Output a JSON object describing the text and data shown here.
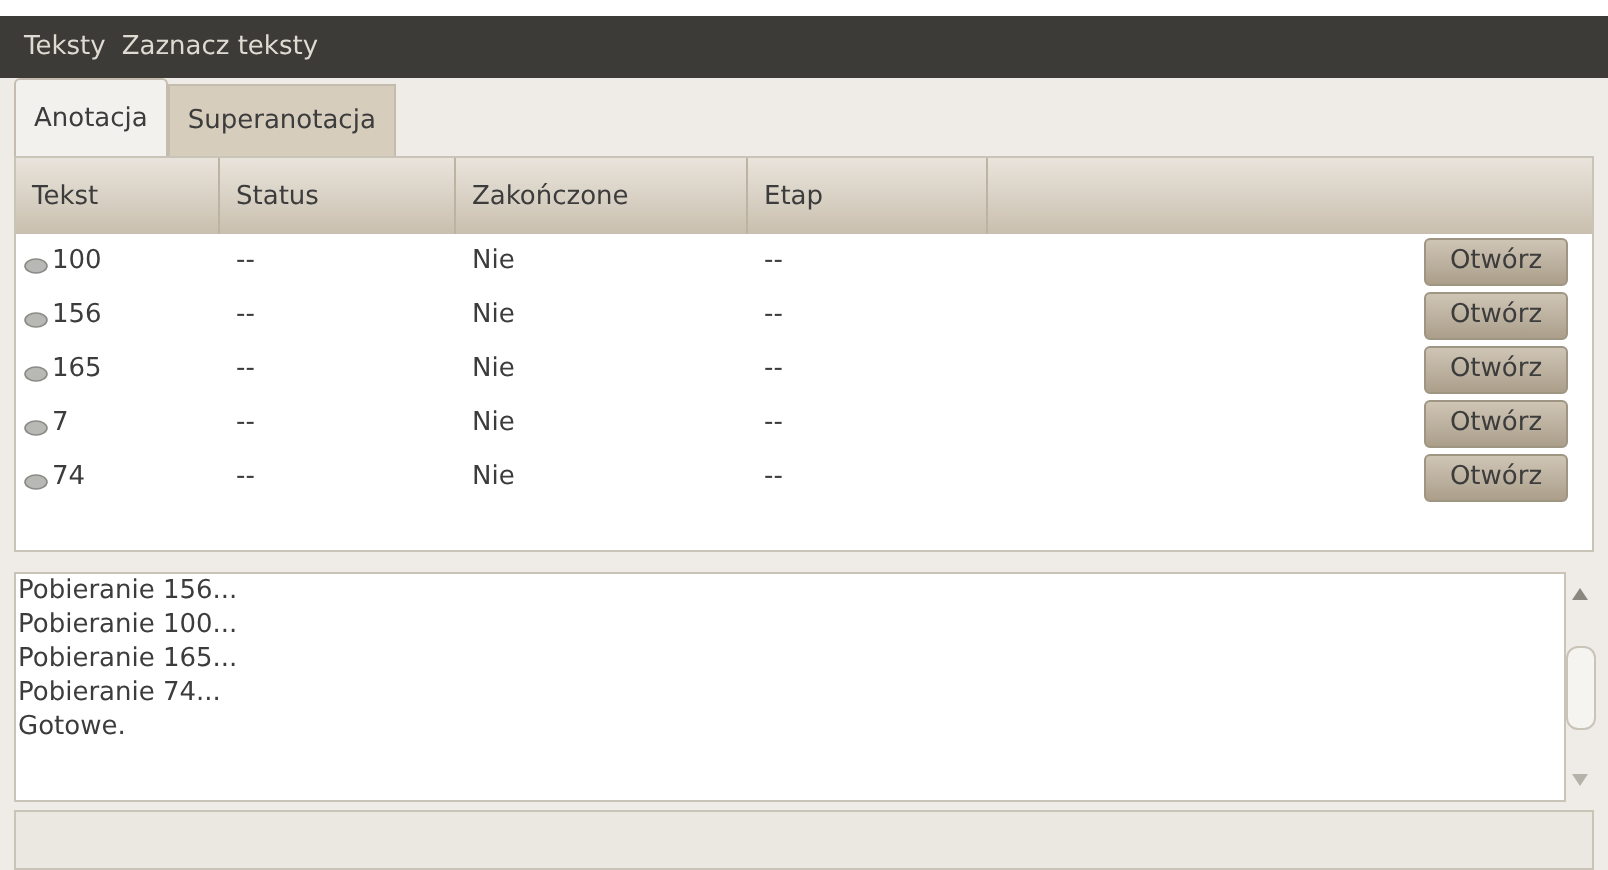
{
  "menu_bar": {
    "items": [
      "Teksty",
      "Zaznacz teksty"
    ]
  },
  "tabs": [
    {
      "label": "Anotacja",
      "selected": true
    },
    {
      "label": "Superanotacja",
      "selected": false
    }
  ],
  "table": {
    "columns": [
      "Tekst",
      "Status",
      "Zakończone",
      "Etap"
    ],
    "rows": [
      {
        "tekst": "100",
        "status": "--",
        "zakonczone": "Nie",
        "etap": "--",
        "button": "Otwórz"
      },
      {
        "tekst": "156",
        "status": "--",
        "zakonczone": "Nie",
        "etap": "--",
        "button": "Otwórz"
      },
      {
        "tekst": "165",
        "status": "--",
        "zakonczone": "Nie",
        "etap": "--",
        "button": "Otwórz"
      },
      {
        "tekst": "7",
        "status": "--",
        "zakonczone": "Nie",
        "etap": "--",
        "button": "Otwórz"
      },
      {
        "tekst": "74",
        "status": "--",
        "zakonczone": "Nie",
        "etap": "--",
        "button": "Otwórz"
      }
    ]
  },
  "log": {
    "lines": [
      "Pobieranie 156...",
      "Pobieranie 100...",
      "Pobieranie 165...",
      "Pobieranie 74...",
      "Gotowe."
    ]
  }
}
